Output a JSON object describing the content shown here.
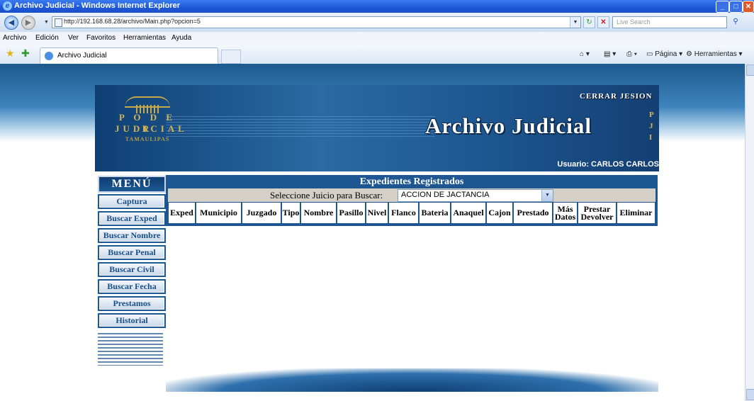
{
  "browser": {
    "window_title": "Archivo Judicial - Windows Internet Explorer",
    "url": "http://192.168.68.28/archivo/Main.php?opcion=5",
    "search_placeholder": "Live Search",
    "menu": [
      "Archivo",
      "Edición",
      "Ver",
      "Favoritos",
      "Herramientas",
      "Ayuda"
    ],
    "tab_label": "Archivo Judicial",
    "cmd_page": "Página",
    "cmd_tools": "Herramientas"
  },
  "header": {
    "logo_line1": "P O D E R",
    "logo_line2": "JUDICIAL",
    "logo_line3": "TAMAULIPAS",
    "logout": "CERRAR JESION",
    "title": "Archivo Judicial",
    "user": "Usuario: CARLOS CARLOS"
  },
  "menu": {
    "title": "MENÚ",
    "items": [
      {
        "label": "Captura"
      },
      {
        "label": "Buscar Exped"
      },
      {
        "label": "Buscar Nombre"
      },
      {
        "label": "Buscar Penal"
      },
      {
        "label": "Buscar Civil"
      },
      {
        "label": "Buscar Fecha"
      },
      {
        "label": "Prestamos"
      },
      {
        "label": "Historial"
      }
    ]
  },
  "content": {
    "title": "Expedientes Registrados",
    "select_label": "Seleccione Juicio para Buscar:",
    "select_value": "ACCION DE JACTANCIA",
    "columns": [
      {
        "label": "Exped"
      },
      {
        "label": "Municipio"
      },
      {
        "label": "Juzgado"
      },
      {
        "label": "Tipo"
      },
      {
        "label": "Nombre"
      },
      {
        "label": "Pasillo"
      },
      {
        "label": "Nivel"
      },
      {
        "label": "Flanco"
      },
      {
        "label": "Bateria"
      },
      {
        "label": "Anaquel"
      },
      {
        "label": "Cajon"
      },
      {
        "label": "Prestado"
      },
      {
        "label1": "Más",
        "label2": "Datos"
      },
      {
        "label1": "Prestar",
        "label2": "Devolver"
      },
      {
        "label": "Eliminar"
      }
    ]
  }
}
